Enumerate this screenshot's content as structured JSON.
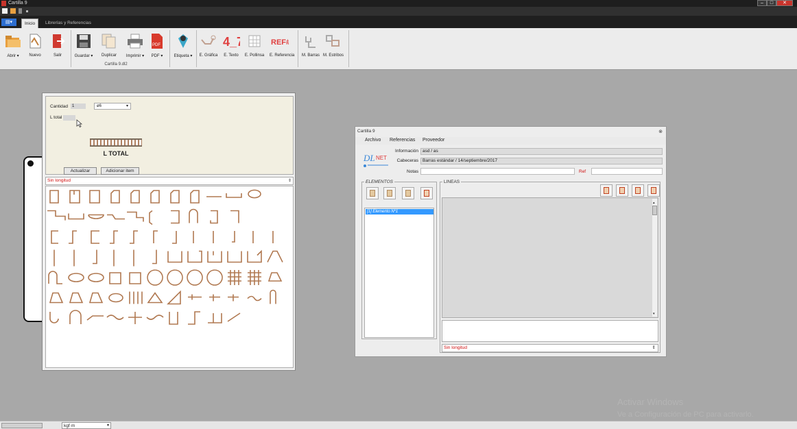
{
  "window": {
    "title": "Cartilla 9"
  },
  "tabs": [
    {
      "label": "Inicio",
      "active": true
    },
    {
      "label": "Librerías y Referencias",
      "active": false
    }
  ],
  "ribbon": {
    "buttons": [
      {
        "id": "abrir",
        "label": "Abrir"
      },
      {
        "id": "nuevo",
        "label": "Nuevo"
      },
      {
        "id": "salir",
        "label": "Salir"
      },
      {
        "id": "guardar",
        "label": "Guardar"
      },
      {
        "id": "duplicar",
        "label": "Duplicar"
      },
      {
        "id": "imprimir",
        "label": "Imprimir"
      },
      {
        "id": "pdf",
        "label": "PDF"
      },
      {
        "id": "etiqueta",
        "label": "Etiqueta"
      },
      {
        "id": "e-grafica",
        "label": "E. Gráfica"
      },
      {
        "id": "e-texto",
        "label": "E. Texto"
      },
      {
        "id": "e-pollinsa",
        "label": "E. Pollinsa"
      },
      {
        "id": "e-referencia",
        "label": "E. Referencia"
      },
      {
        "id": "m-barras",
        "label": "M. Barras"
      },
      {
        "id": "m-estribos",
        "label": "M. Estribos"
      }
    ],
    "group_label": "Cartilla 9.dl2",
    "icon_text": {
      "etexto": "4_7",
      "eref": "REF#",
      "pdf": "PDF"
    }
  },
  "left_panel": {
    "cantidad_label": "Cantidad",
    "cantidad_value": "1",
    "diametro_value": "ø6",
    "ltotal_label": "L total",
    "ltotal_caption": "L TOTAL",
    "actualizar": "Actualizar",
    "adicionar": "Adicionar item",
    "filter": "Sin longitud"
  },
  "right_window": {
    "title": "Cartilla 9",
    "menu": [
      "Archivo",
      "Referencias",
      "Proveedor"
    ],
    "informacion_label": "Información",
    "informacion_value": "asd / as",
    "cabeceras_label": "Cabeceras",
    "cabeceras_value": "Barras estándar / 14/septiembre/2017",
    "notas_label": "Notas",
    "ref_label": "Ref",
    "elementos_title": "ELEMENTOS",
    "lineas_title": "LINEAS",
    "element_item": "[1]  Elemento Nº1",
    "lineas_filter": "Sin longitud"
  },
  "status_bar": {
    "units": "kgf·m"
  },
  "watermark": [
    "Activar Windows",
    "Ve a Configuración de PC para activarlo."
  ],
  "colors": {
    "accent": "#2e6fd1",
    "selection": "#3399ff",
    "alert": "#d01010",
    "workspace": "#a8a8a8"
  }
}
